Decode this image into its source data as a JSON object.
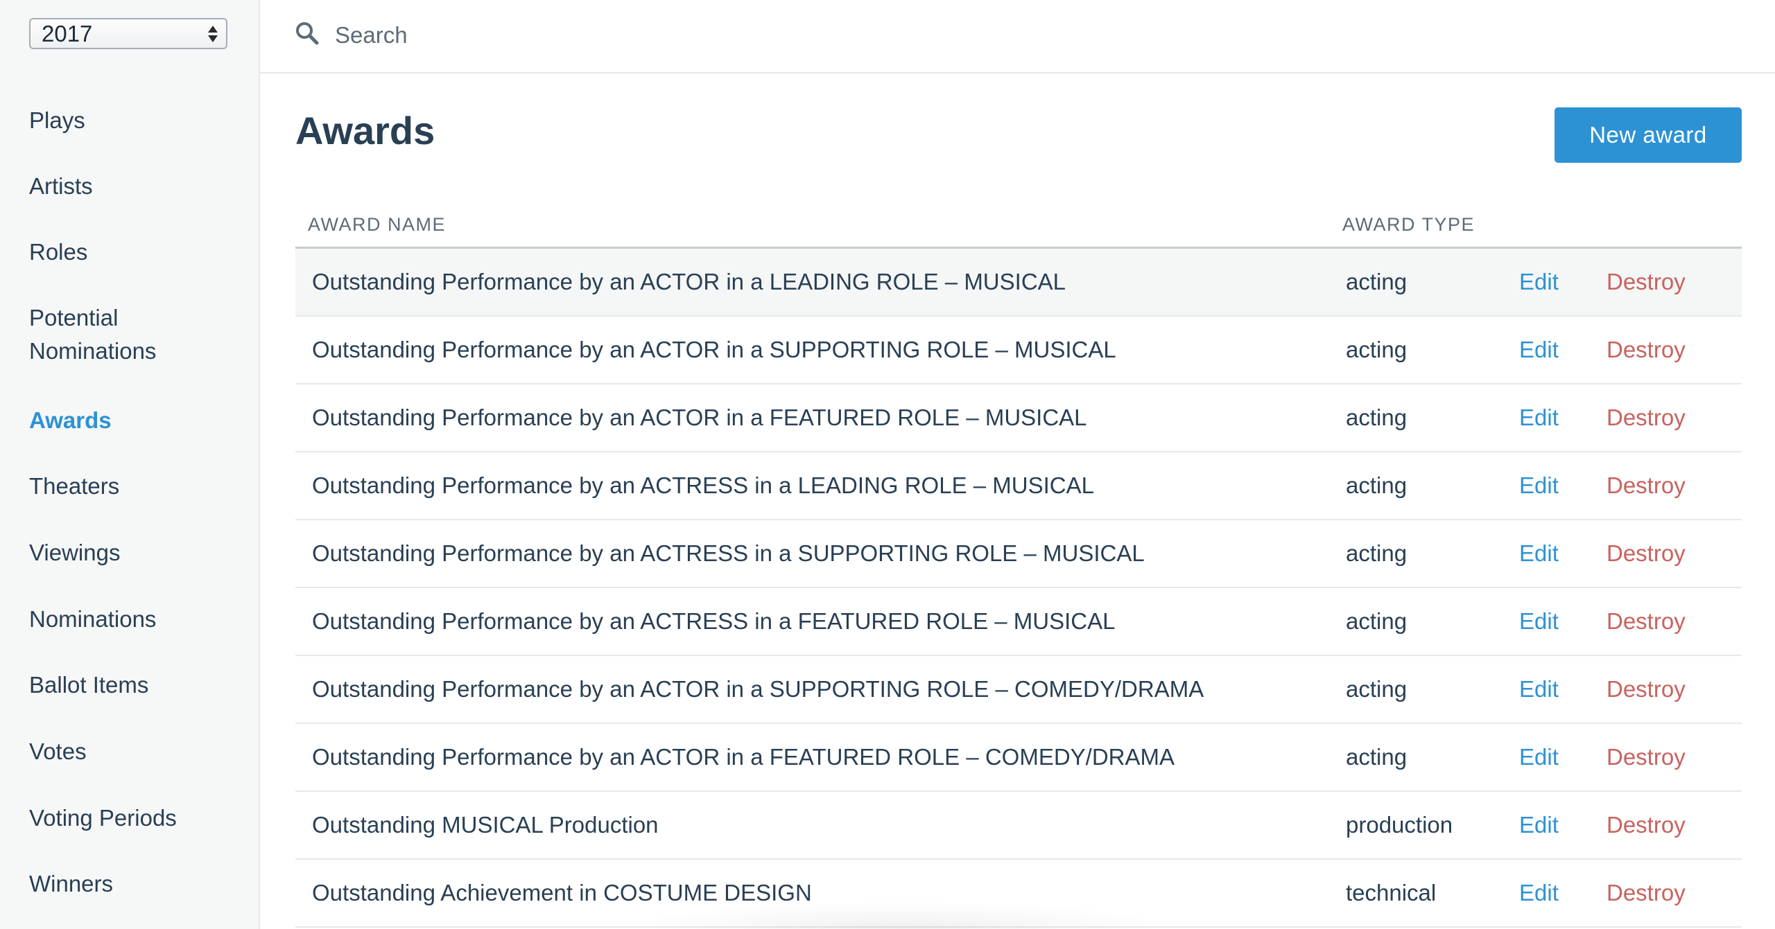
{
  "sidebar": {
    "year_select": {
      "value": "2017"
    },
    "items": [
      {
        "label": "Plays",
        "active": false
      },
      {
        "label": "Artists",
        "active": false
      },
      {
        "label": "Roles",
        "active": false
      },
      {
        "label": "Potential Nominations",
        "active": false
      },
      {
        "label": "Awards",
        "active": true
      },
      {
        "label": "Theaters",
        "active": false
      },
      {
        "label": "Viewings",
        "active": false
      },
      {
        "label": "Nominations",
        "active": false
      },
      {
        "label": "Ballot Items",
        "active": false
      },
      {
        "label": "Votes",
        "active": false
      },
      {
        "label": "Voting Periods",
        "active": false
      },
      {
        "label": "Winners",
        "active": false
      }
    ]
  },
  "search": {
    "placeholder": "Search",
    "value": "",
    "icon": "search-icon"
  },
  "main": {
    "title": "Awards",
    "new_button_label": "New award",
    "table": {
      "headers": {
        "name": "AWARD NAME",
        "type": "AWARD TYPE"
      },
      "rows": [
        {
          "name": "Outstanding Performance by an ACTOR in a LEADING ROLE – MUSICAL",
          "type": "acting",
          "edit": "Edit",
          "destroy": "Destroy"
        },
        {
          "name": "Outstanding Performance by an ACTOR in a SUPPORTING ROLE – MUSICAL",
          "type": "acting",
          "edit": "Edit",
          "destroy": "Destroy"
        },
        {
          "name": "Outstanding Performance by an ACTOR in a FEATURED ROLE – MUSICAL",
          "type": "acting",
          "edit": "Edit",
          "destroy": "Destroy"
        },
        {
          "name": "Outstanding Performance by an ACTRESS in a LEADING ROLE – MUSICAL",
          "type": "acting",
          "edit": "Edit",
          "destroy": "Destroy"
        },
        {
          "name": "Outstanding Performance by an ACTRESS in a SUPPORTING ROLE – MUSICAL",
          "type": "acting",
          "edit": "Edit",
          "destroy": "Destroy"
        },
        {
          "name": "Outstanding Performance by an ACTRESS in a FEATURED ROLE – MUSICAL",
          "type": "acting",
          "edit": "Edit",
          "destroy": "Destroy"
        },
        {
          "name": "Outstanding Performance by an ACTOR in a SUPPORTING ROLE – COMEDY/DRAMA",
          "type": "acting",
          "edit": "Edit",
          "destroy": "Destroy"
        },
        {
          "name": "Outstanding Performance by an ACTOR in a FEATURED ROLE – COMEDY/DRAMA",
          "type": "acting",
          "edit": "Edit",
          "destroy": "Destroy"
        },
        {
          "name": "Outstanding MUSICAL Production",
          "type": "production",
          "edit": "Edit",
          "destroy": "Destroy"
        },
        {
          "name": "Outstanding Achievement in COSTUME DESIGN",
          "type": "technical",
          "edit": "Edit",
          "destroy": "Destroy"
        }
      ]
    }
  },
  "colors": {
    "accent": "#2c92d4",
    "destroy": "#c8625e",
    "text": "#293f54",
    "sidebar_bg": "#f6f7f7"
  }
}
